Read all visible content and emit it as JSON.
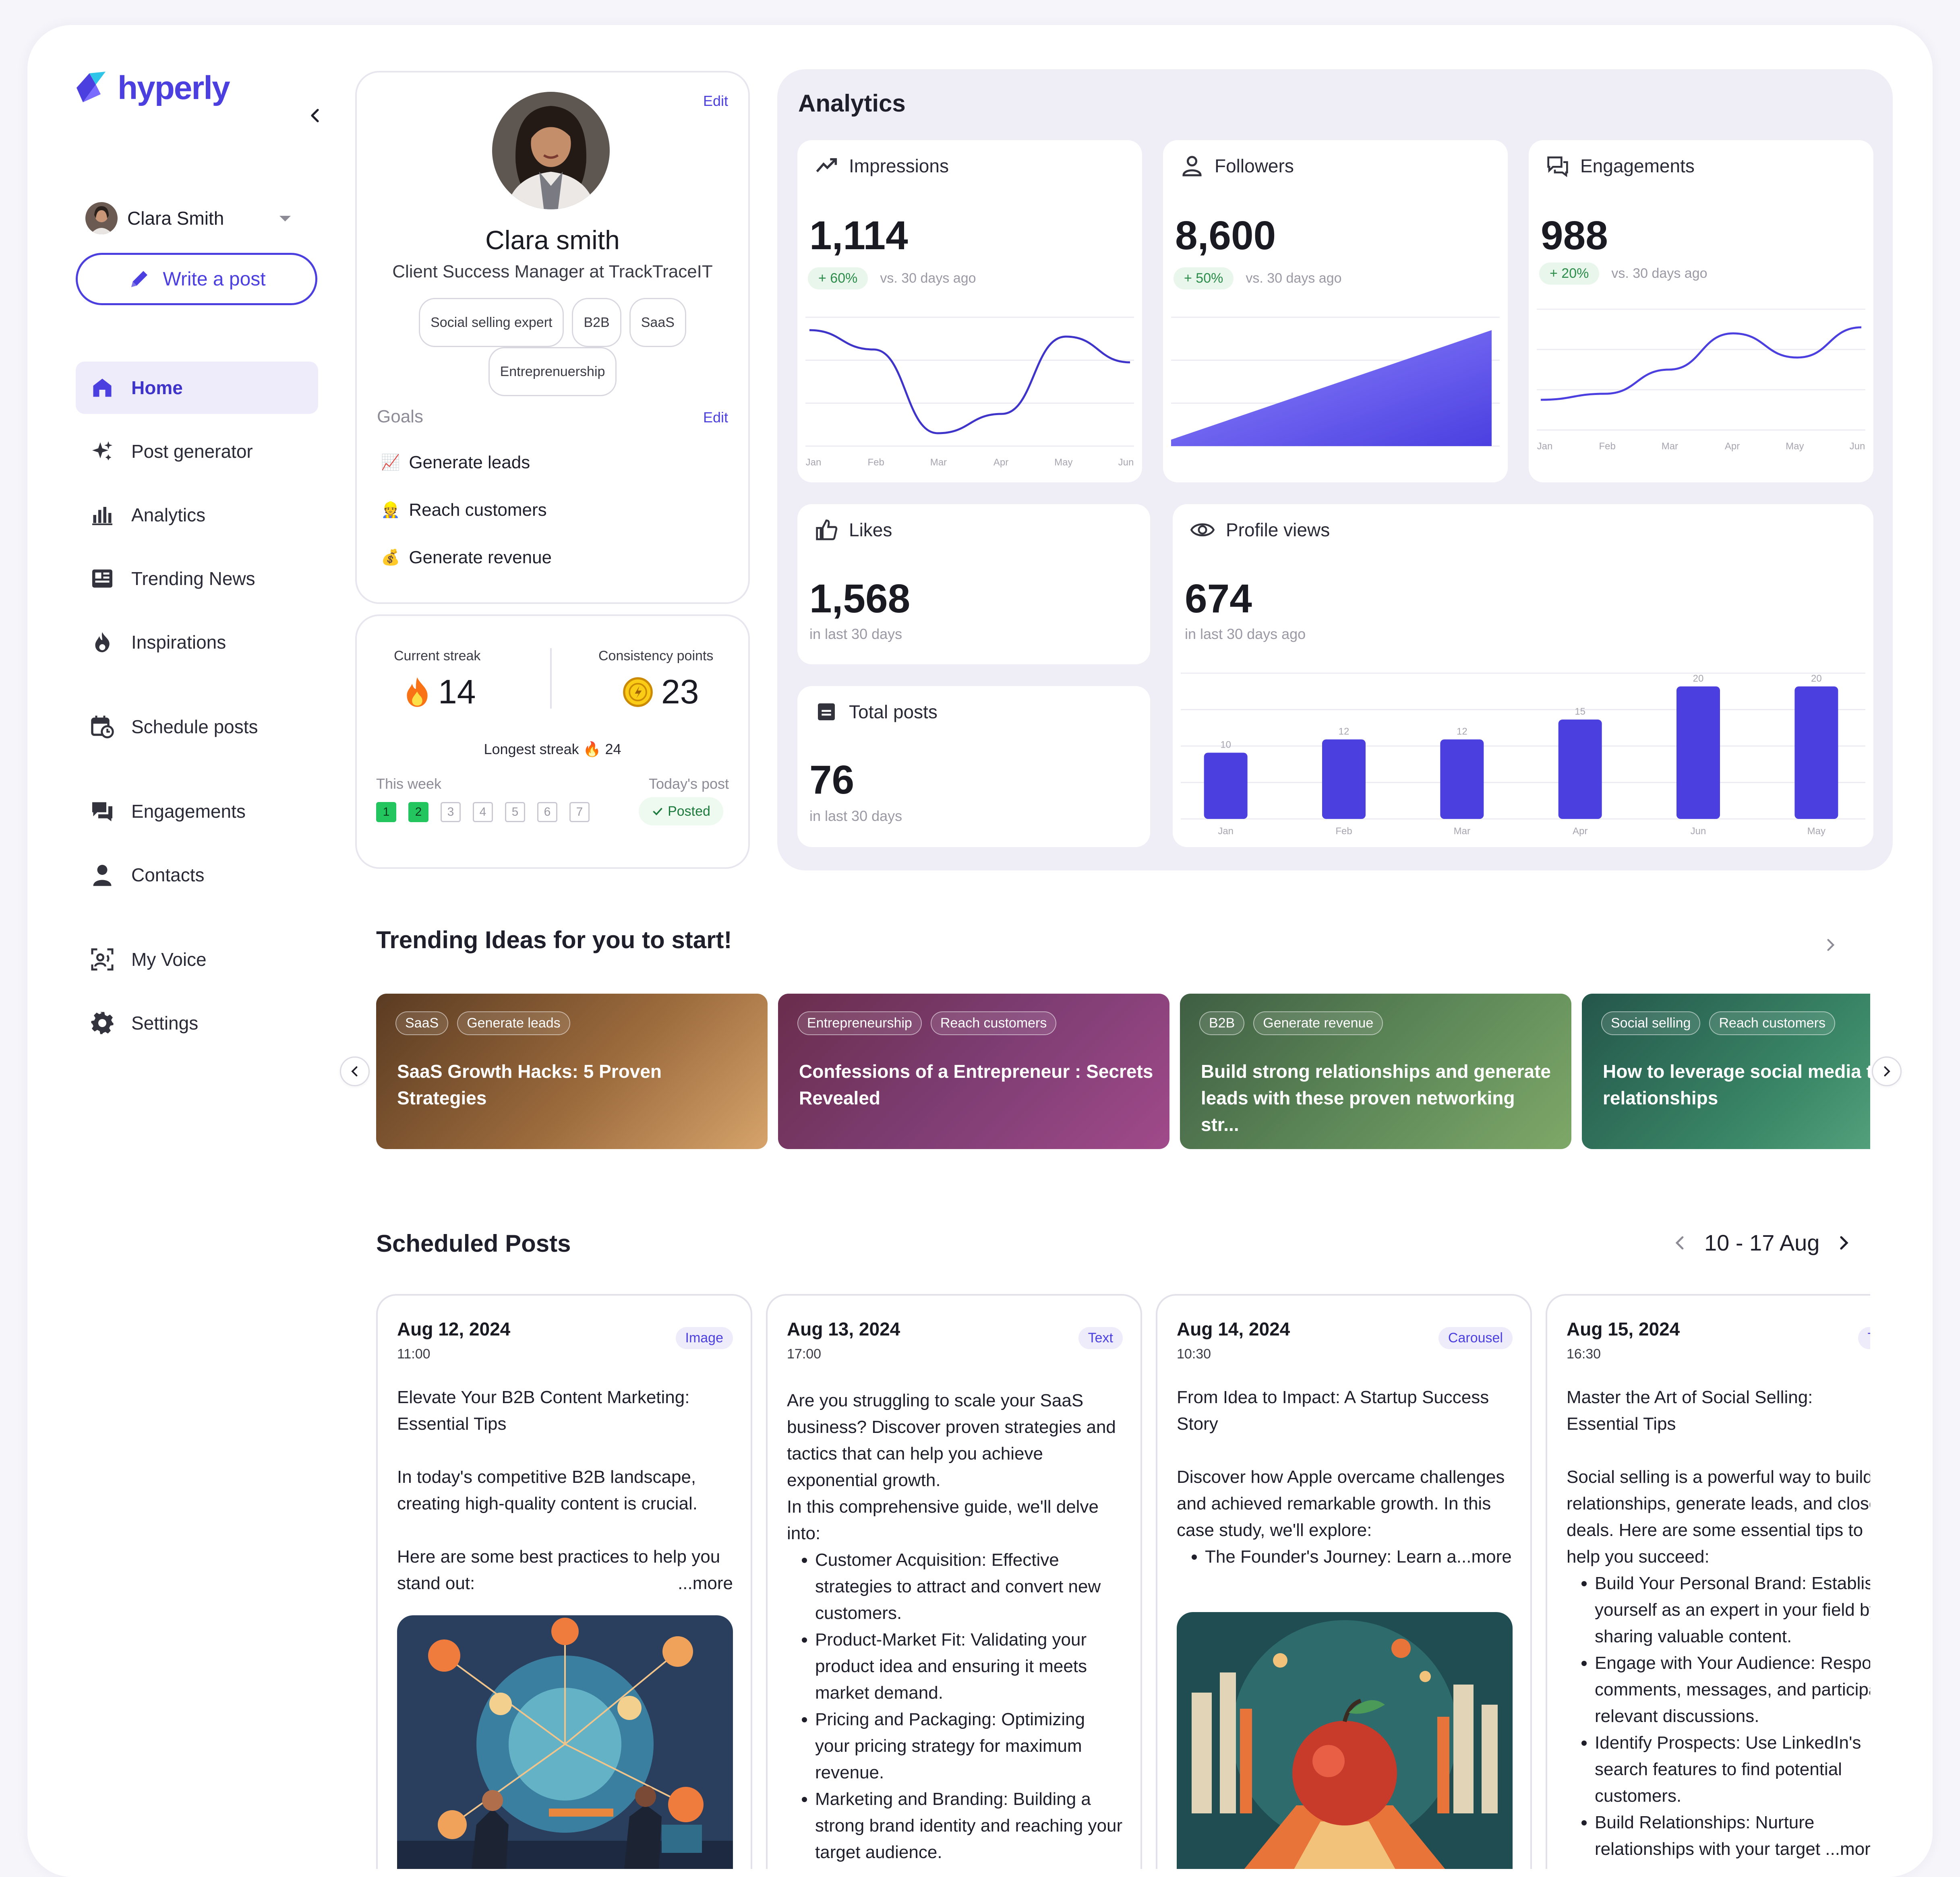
{
  "brand": {
    "name": "hyperly",
    "accent": "#4b3fe0"
  },
  "user": {
    "name": "Clara Smith"
  },
  "sidebar": {
    "write_label": "Write a post",
    "items": [
      {
        "label": "Home",
        "icon": "home-icon"
      },
      {
        "label": "Post generator",
        "icon": "sparkle-icon"
      },
      {
        "label": "Analytics",
        "icon": "bar-chart-icon"
      },
      {
        "label": "Trending News",
        "icon": "newspaper-icon"
      },
      {
        "label": "Inspirations",
        "icon": "flame-icon"
      },
      {
        "label": "Schedule posts",
        "icon": "calendar-clock-icon"
      },
      {
        "label": "Engagements",
        "icon": "chat-bubbles-icon"
      },
      {
        "label": "Contacts",
        "icon": "person-icon"
      },
      {
        "label": "My Voice",
        "icon": "voice-scan-icon"
      },
      {
        "label": "Settings",
        "icon": "gear-icon"
      }
    ]
  },
  "profile": {
    "edit_label": "Edit",
    "name": "Clara smith",
    "role": "Client Success Manager at TrackTraceIT",
    "tags": [
      "Social selling expert",
      "B2B",
      "SaaS",
      "Entreprenuership"
    ],
    "goals_title": "Goals",
    "goals_edit": "Edit",
    "goals": [
      {
        "icon": "📈",
        "label": "Generate leads"
      },
      {
        "icon": "👷",
        "label": "Reach customers"
      },
      {
        "icon": "💰",
        "label": "Generate revenue"
      }
    ]
  },
  "streak": {
    "current_label": "Current streak",
    "current_value": "14",
    "points_label": "Consistency points",
    "points_value": "23",
    "longest_label": "Longest streak",
    "longest_value": "24",
    "week_label": "This week",
    "today_label": "Today's post",
    "days": [
      "1",
      "2",
      "3",
      "4",
      "5",
      "6",
      "7"
    ],
    "days_done": 2,
    "posted_label": "Posted"
  },
  "analytics": {
    "title": "Analytics",
    "impressions": {
      "label": "Impressions",
      "value": "1,114",
      "delta": "+ 60%",
      "vs": "vs. 30 days ago",
      "chart_data": {
        "type": "line",
        "x": [
          "Jan",
          "Feb",
          "Mar",
          "Apr",
          "May",
          "Jun"
        ],
        "y": [
          0.9,
          0.75,
          0.1,
          0.25,
          0.85,
          0.65
        ]
      }
    },
    "followers": {
      "label": "Followers",
      "value": "8,600",
      "delta": "+ 50%",
      "vs": "vs. 30 days ago",
      "chart_data": {
        "type": "area",
        "x": [
          0,
          1
        ],
        "y": [
          0.05,
          0.9
        ]
      }
    },
    "engagements": {
      "label": "Engagements",
      "value": "988",
      "delta": "+ 20%",
      "vs": "vs. 30 days ago",
      "chart_data": {
        "type": "line",
        "x": [
          "Jan",
          "Feb",
          "Mar",
          "Apr",
          "May",
          "Jun"
        ],
        "y": [
          0.25,
          0.3,
          0.5,
          0.8,
          0.6,
          0.85
        ]
      }
    },
    "likes": {
      "label": "Likes",
      "value": "1,568",
      "sub": "in last 30 days"
    },
    "total_posts": {
      "label": "Total posts",
      "value": "76",
      "sub": "in last 30 days"
    },
    "profile_views": {
      "label": "Profile views",
      "value": "674",
      "sub": "in last 30 days ago",
      "chart_data": {
        "type": "bar",
        "categories": [
          "Jan",
          "Feb",
          "Mar",
          "Apr",
          "Jun",
          "May"
        ],
        "values": [
          10,
          12,
          12,
          15,
          20,
          20
        ],
        "ylim": [
          0,
          22
        ]
      }
    }
  },
  "trending": {
    "title": "Trending Ideas for you to start!",
    "cards": [
      {
        "tags": [
          "SaaS",
          "Generate leads"
        ],
        "title": "SaaS Growth Hacks: 5 Proven Strategies",
        "bg": "#9a6b3c"
      },
      {
        "tags": [
          "Entrepreneurship",
          "Reach customers"
        ],
        "title": "Confessions of a Entrepreneur : Secrets Revealed",
        "bg": "#7b3e73"
      },
      {
        "tags": [
          "B2B",
          "Generate revenue"
        ],
        "title": "Build strong relationships and generate leads with these proven networking str...",
        "bg": "#5f8a59"
      },
      {
        "tags": [
          "Social selling",
          "Reach customers"
        ],
        "title": "How to leverage social media to build relationships",
        "bg": "#3b8868"
      }
    ]
  },
  "scheduled": {
    "title": "Scheduled Posts",
    "range": "10 - 17 Aug",
    "posts": [
      {
        "date": "Aug 12, 2024",
        "time": "11:00",
        "type": "Image",
        "paras": [
          "Elevate Your B2B Content Marketing: Essential Tips",
          "In today's competitive B2B landscape, creating high-quality content is crucial.",
          "Here are some best practices to help you stand out:"
        ],
        "bullets": [],
        "more": "...more"
      },
      {
        "date": "Aug 13, 2024",
        "time": "17:00",
        "type": "Text",
        "paras": [
          "Are you struggling to scale your SaaS business? Discover proven strategies and tactics that can help you achieve exponential growth.",
          "In this comprehensive guide, we'll delve into:"
        ],
        "bullets": [
          "Customer Acquisition: Effective strategies to attract and convert new customers.",
          "Product-Market Fit: Validating your product idea and ensuring it meets market demand.",
          "Pricing and Packaging: Optimizing your pricing strategy for maximum revenue.",
          "Marketing and Branding: Building a strong brand identity and reaching your target audience."
        ],
        "more": ""
      },
      {
        "date": "Aug 14, 2024",
        "time": "10:30",
        "type": "Carousel",
        "paras": [
          "From Idea to Impact: A Startup Success Story",
          "Discover how Apple overcame challenges and achieved remarkable growth. In this case study, we'll explore:"
        ],
        "bullets": [
          "The Founder's Journey: Learn a"
        ],
        "more": "...more"
      },
      {
        "date": "Aug 15, 2024",
        "time": "16:30",
        "type": "Text",
        "paras": [
          "Master the Art of Social Selling: Essential Tips",
          "Social selling is a powerful way to build relationships, generate leads, and close deals. Here are some essential tips to help you succeed:"
        ],
        "bullets": [
          "Build Your Personal Brand: Establish yourself as an expert in your field by sharing valuable content.",
          "Engage with Your Audience: Respond to comments, messages, and participate in relevant discussions.",
          "Identify Prospects: Use LinkedIn's search features to find potential customers.",
          "Build Relationships: Nurture relationships with your target"
        ],
        "more": "...more"
      }
    ]
  }
}
